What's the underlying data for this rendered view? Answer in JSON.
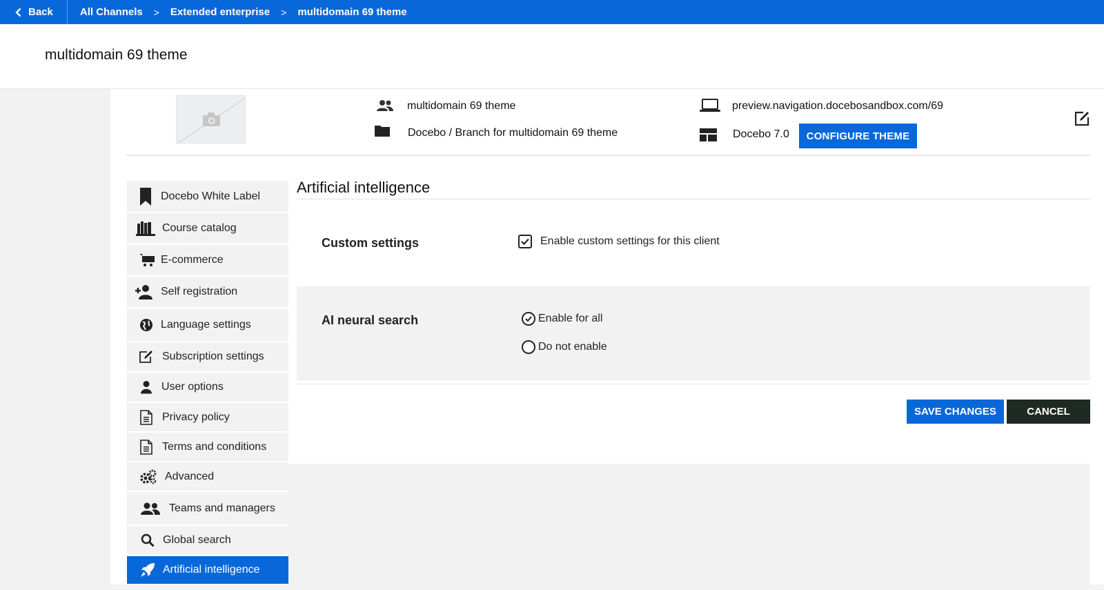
{
  "topbar": {
    "back_label": "Back",
    "breadcrumbs": [
      "All Channels",
      "Extended enterprise",
      "multidomain 69 theme"
    ],
    "separator": ">",
    "color": "#0868d9"
  },
  "page": {
    "title": "multidomain 69 theme"
  },
  "info": {
    "thumbnail_icon": "camera-icon",
    "name": "multidomain 69 theme",
    "branch": "Docebo / Branch for multidomain 69 theme",
    "url": "preview.navigation.docebosandbox.com/69",
    "theme": "Docebo 7.0",
    "configure_label": "CONFIGURE THEME",
    "edit_icon": "edit-icon"
  },
  "menu": {
    "items": [
      {
        "label": "Docebo White Label",
        "icon": "bookmark-icon"
      },
      {
        "label": "Course catalog",
        "icon": "books-icon"
      },
      {
        "label": "E-commerce",
        "icon": "cart-icon"
      },
      {
        "label": "Self registration",
        "icon": "add-user-icon"
      },
      {
        "label": "Language settings",
        "icon": "globe-icon"
      },
      {
        "label": "Subscription settings",
        "icon": "pencil-square-icon"
      },
      {
        "label": "User options",
        "icon": "user-icon"
      },
      {
        "label": "Privacy policy",
        "icon": "document-icon"
      },
      {
        "label": "Terms and conditions",
        "icon": "document-icon"
      },
      {
        "label": "Advanced",
        "icon": "gears-icon"
      },
      {
        "label": "Teams and managers",
        "icon": "team-icon"
      },
      {
        "label": "Global search",
        "icon": "search-icon"
      },
      {
        "label": "Artificial intelligence",
        "icon": "rocket-icon",
        "active": true
      }
    ],
    "active_color": "#0868d9"
  },
  "main": {
    "section_title": "Artificial intelligence",
    "custom_settings": {
      "label": "Custom settings",
      "checkbox_label": "Enable custom settings for this client",
      "checked": true
    },
    "ai_neural_search": {
      "label": "AI neural search",
      "options": [
        {
          "label": "Enable for all",
          "selected": true
        },
        {
          "label": "Do not enable",
          "selected": false
        }
      ]
    },
    "save_label": "SAVE CHANGES",
    "cancel_label": "CANCEL"
  }
}
